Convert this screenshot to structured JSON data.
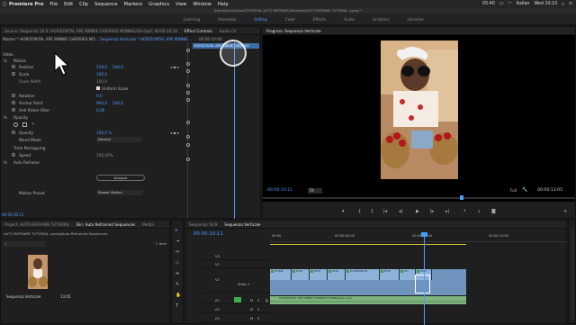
{
  "menubar": {
    "apple": "",
    "items": [
      "Premiere Pro",
      "File",
      "Edit",
      "Clip",
      "Sequence",
      "Markers",
      "Graphics",
      "View",
      "Window",
      "Help"
    ],
    "status_left": "05:40",
    "status_lang": "Italian",
    "clock": "Wed 20:10"
  },
  "title": "/Users/lelvio/Lavori/TUTORIAL AUTO REFRAME/Premiere/AUTO REFRAME TUTORIAL .prproj *",
  "workspaces": [
    "Learning",
    "Assembly",
    "Editing",
    "Color",
    "Effects",
    "Audio",
    "Graphics",
    "Libraries"
  ],
  "workspace_active": "Editing",
  "left_panel": {
    "source_tab": "Source: Sequenza 16:9: HORIZONTAL APE MINNIE CHERRIES MONNALISA.mp4: 00:00:10:10",
    "effect_controls_tab": "Effect Controls",
    "audio_tab": "Audio Cli",
    "master_label": "Master * HORIZONTAL APE MINNIE CHERRIES MO...",
    "sequence_link": "Sequenza Verticale * HORIZONTAL APE MINNIE...",
    "timecode_top": "00:00:10:00",
    "clip_bar": "HORIZONTAL APE MINNIE CHERRIES",
    "video_header": "Video",
    "motion": "Motion",
    "position_label": "Position",
    "position_x": "239,0",
    "position_y": "540,0",
    "scale_label": "Scale",
    "scale_val": "100,0",
    "scale_width_label": "Scale Width",
    "scale_width_val": "100,0",
    "uniform_scale": "Uniform Scale",
    "rotation_label": "Rotation",
    "rotation_val": "0,0",
    "anchor_label": "Anchor Point",
    "anchor_x": "960,0",
    "anchor_y": "540,0",
    "antiflicker_label": "Anti-flicker Filter",
    "antiflicker_val": "0,00",
    "opacity": "Opacity",
    "opacity_label": "Opacity",
    "opacity_val": "100,0 %",
    "blend_label": "Blend Mode",
    "blend_val": "Normal",
    "time_remap": "Time Remapping",
    "speed_label": "Speed",
    "speed_val": "100,00%",
    "auto_reframe": "Auto Reframe",
    "analyze_btn": "Analyze",
    "motion_preset_label": "Motion Preset",
    "motion_preset_val": "Slower Motion",
    "bottom_tc": "00:00:10:11"
  },
  "program": {
    "tab": "Program: Sequenza Verticale",
    "timecode": "00:00:10:11",
    "fit": "Fit",
    "quality": "Full",
    "duration": "00:00:13:05"
  },
  "project": {
    "tab_project": "Project: AUTO REFRAME TUTORIAL",
    "tab_bin": "Bin: Auto Reframed Sequences",
    "tab_media": "Media",
    "path": "AUTO REFRAME TUTORIAL .prproj\\Auto Reframed Sequences",
    "item_count": "1 Item",
    "item_name": "Sequenza Verticale",
    "item_duration": "13:05"
  },
  "timeline": {
    "tab_seq169": "Sequenza 16:9",
    "tab_vertical": "Sequenza Verticale",
    "timecode": "00:00:10:11",
    "ruler": [
      "00:00",
      "00:00:05:00",
      "00:00:10:00",
      "00:00:15:00"
    ],
    "tracks_video": [
      "V3",
      "V2",
      "V1"
    ],
    "tracks_audio": [
      "A1",
      "A2",
      "A3"
    ],
    "video1_label": "Video 1",
    "clip_labels": [
      "HORIZ",
      "HOR",
      "HOR",
      "HOR",
      "HORIZONTAL",
      "HOR",
      "HO",
      "HOR"
    ],
    "audio_clip": "HORIZONTAL APE MINNIE CHERRIES MONNALISA.mp4"
  },
  "colors": {
    "accent_blue": "#4b9cff",
    "clip_video": "#8fb3d8",
    "clip_audio": "#7fb47f",
    "playhead": "#4b9cff"
  }
}
